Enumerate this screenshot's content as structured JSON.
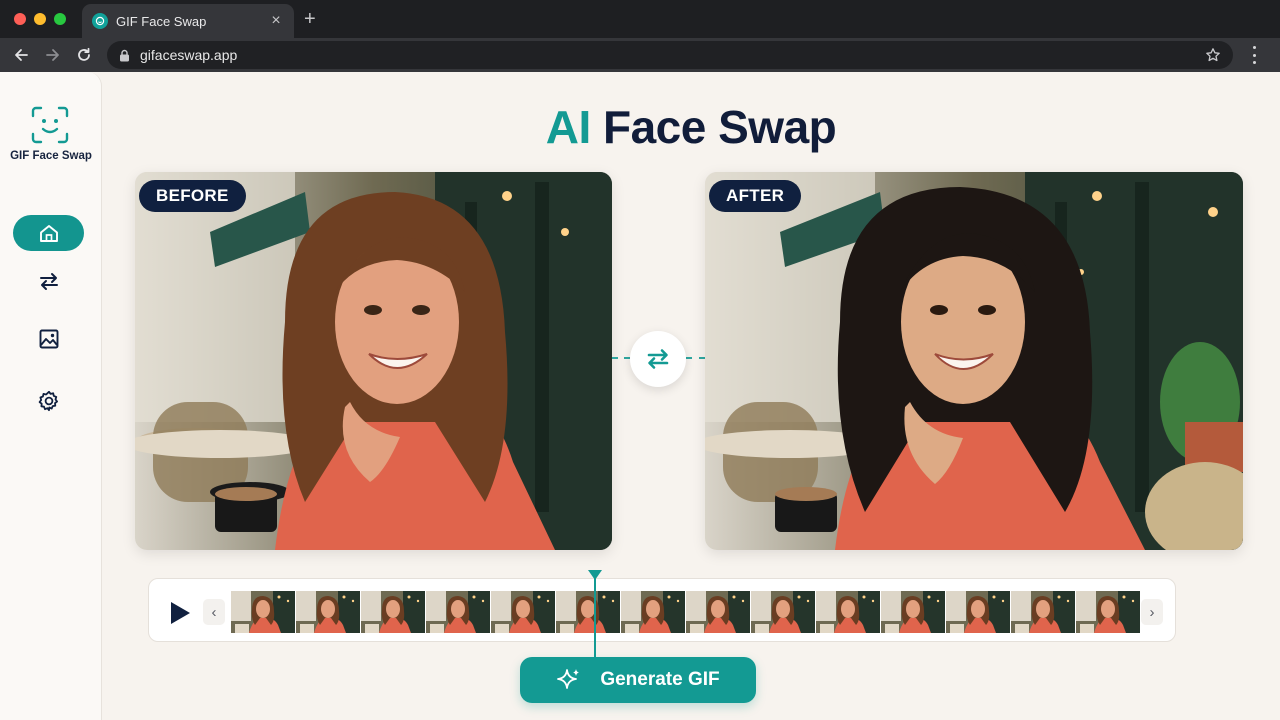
{
  "browser": {
    "tab_title": "GIF Face Swap",
    "url": "gifaceswap.app"
  },
  "app": {
    "logo_text": "GIF Face Swap",
    "nav": [
      {
        "icon": "home-icon",
        "active": true
      },
      {
        "icon": "swap-icon",
        "active": false
      },
      {
        "icon": "image-icon",
        "active": false
      },
      {
        "icon": "gear-icon",
        "active": false
      }
    ],
    "headline": {
      "accent": "AI",
      "rest": "Face Swap"
    },
    "before_label": "BEFORE",
    "after_label": "AFTER",
    "generate_label": "Generate GIF",
    "frame_count": 14
  },
  "colors": {
    "accent": "#139a93",
    "navy": "#111d3a",
    "background": "#f7f3ee",
    "jacket": "#e0644c"
  }
}
